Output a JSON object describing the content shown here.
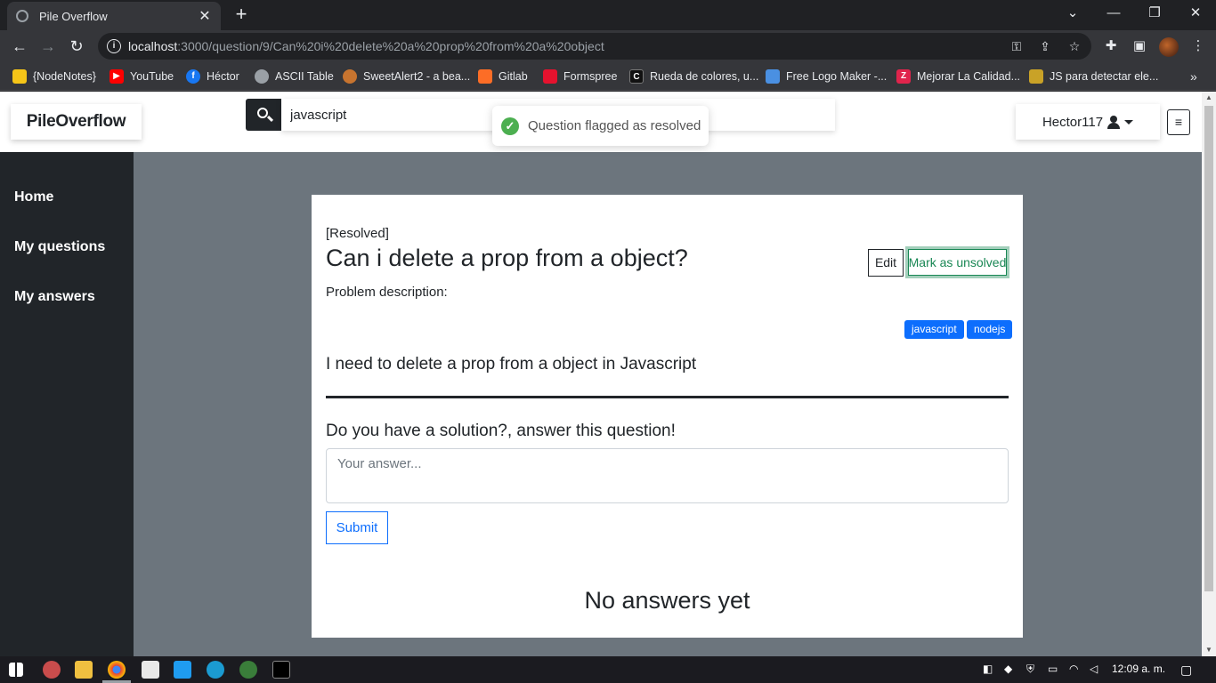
{
  "browser": {
    "tab_title": "Pile Overflow",
    "url_host": "localhost",
    "url_path": ":3000/question/9/Can%20i%20delete%20a%20prop%20from%20a%20object",
    "bookmarks": [
      {
        "label": "{NodeNotes}",
        "color": "#f5c518"
      },
      {
        "label": "YouTube",
        "color": "#ff0000"
      },
      {
        "label": "Héctor",
        "color": "#1877f2"
      },
      {
        "label": "ASCII Table",
        "color": "#9aa0a6"
      },
      {
        "label": "SweetAlert2 - a bea...",
        "color": "#c7742f"
      },
      {
        "label": "Gitlab",
        "color": "#fc6d26"
      },
      {
        "label": "Formspree",
        "color": "#e5122e"
      },
      {
        "label": "Rueda de colores, u...",
        "color": "#111111"
      },
      {
        "label": "Free Logo Maker -...",
        "color": "#4a90e2"
      },
      {
        "label": "Mejorar La Calidad...",
        "color": "#e0244c"
      },
      {
        "label": "JS para detectar ele...",
        "color": "#c9a227"
      }
    ]
  },
  "app": {
    "brand": "PileOverflow",
    "search_value": "javascript",
    "toast": "Question flagged as resolved",
    "username": "Hector117",
    "sidebar": [
      "Home",
      "My questions",
      "My answers"
    ]
  },
  "question": {
    "status": "[Resolved]",
    "title": "Can i delete a prop from a object?",
    "edit_label": "Edit",
    "unsolve_label": "Mark as unsolved",
    "description_label": "Problem description:",
    "tags": [
      "javascript",
      "nodejs"
    ],
    "body": "I need to delete a prop from a object in Javascript"
  },
  "answer_form": {
    "heading": "Do you have a solution?, answer this question!",
    "placeholder": "Your answer...",
    "submit_label": "Submit"
  },
  "answers": {
    "empty_text": "No answers yet"
  },
  "taskbar": {
    "time": "12:09 a. m."
  }
}
